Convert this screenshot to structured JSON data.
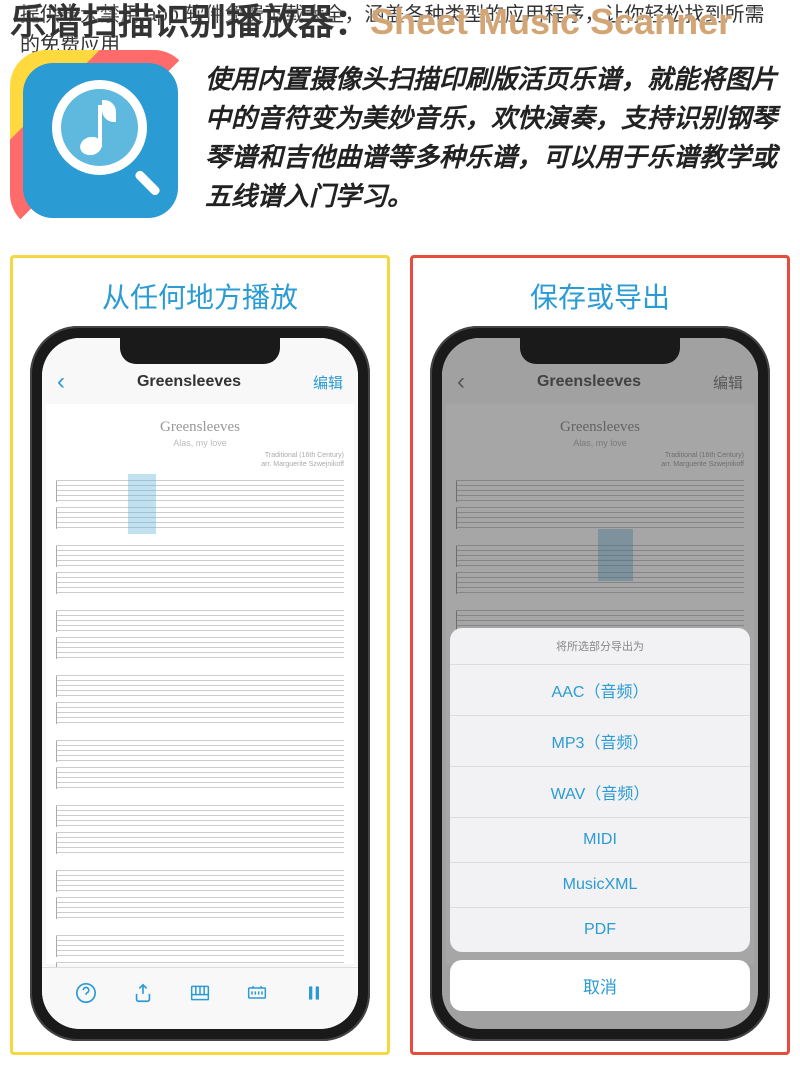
{
  "bgText": "提供十大禁用 app 软件免费下载大全，涵盖各种类型的应用程序，让你轻松找到所需的免费应用",
  "title": {
    "zh": "乐谱扫描识别播放器：",
    "en": "Sheet Music Scanner"
  },
  "appDesc": "使用内置摄像头扫描印刷版活页乐谱，就能将图片中的音符变为美妙音乐，欢快演奏，支持识别钢琴琴谱和吉他曲谱等多种乐谱，可以用于乐谱教学或五线谱入门学习。",
  "cards": {
    "left": {
      "title": "从任何地方播放"
    },
    "right": {
      "title": "保存或导出"
    }
  },
  "phone": {
    "navTitle": "Greensleeves",
    "editLabel": "编辑",
    "sheetTitle": "Greensleeves",
    "sheetSubtitle": "Alas, my love",
    "sheetMeta1": "Traditional (16th Century)",
    "sheetMeta2": "arr. Marguerite Szwejnikoff"
  },
  "actionSheet": {
    "header": "将所选部分导出为",
    "items": [
      "AAC（音频）",
      "MP3（音频）",
      "WAV（音频）",
      "MIDI",
      "MusicXML",
      "PDF"
    ],
    "cancel": "取消"
  },
  "toolbarIcons": [
    "help",
    "export",
    "piano",
    "keyboard-arrows",
    "pause"
  ]
}
